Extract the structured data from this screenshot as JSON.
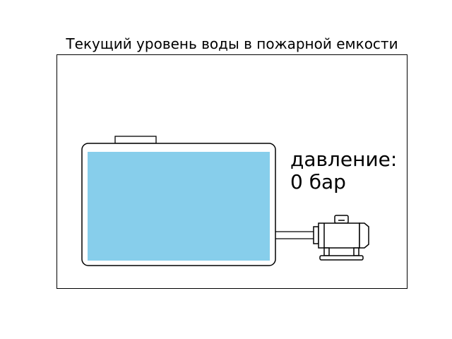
{
  "title": "Текущий уровень воды в пожарной емкости",
  "tank": {
    "water_level_fraction": 1.0,
    "water_color": "#87CEEB"
  },
  "pressure": {
    "label": "давление:",
    "value": "0 бар"
  },
  "icons": {
    "tank": "fire-water-tank-icon",
    "pump": "pump-icon"
  },
  "colors": {
    "stroke": "#000000",
    "background": "#ffffff"
  }
}
